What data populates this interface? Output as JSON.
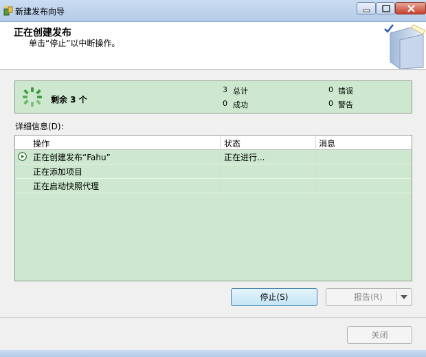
{
  "window": {
    "title": "新建发布向导"
  },
  "header": {
    "title": "正在创建发布",
    "subtitle": "单击“停止”以中断操作。"
  },
  "status": {
    "remaining": "剩余 3 个",
    "total_count": "3",
    "total_label": "总计",
    "success_count": "0",
    "success_label": "成功",
    "error_count": "0",
    "error_label": "错误",
    "warning_count": "0",
    "warning_label": "警告"
  },
  "details": {
    "label": "详细信息(D):",
    "columns": [
      "操作",
      "状态",
      "消息"
    ],
    "rows": [
      {
        "action": "正在创建发布“Fahu”",
        "status": "正在进行...",
        "message": "",
        "icon": "play-icon"
      },
      {
        "action": "正在添加项目",
        "status": "",
        "message": ""
      },
      {
        "action": "正在启动快照代理",
        "status": "",
        "message": ""
      }
    ]
  },
  "buttons": {
    "stop": "停止(S)",
    "report": "报告(R)",
    "close": "关闭"
  }
}
